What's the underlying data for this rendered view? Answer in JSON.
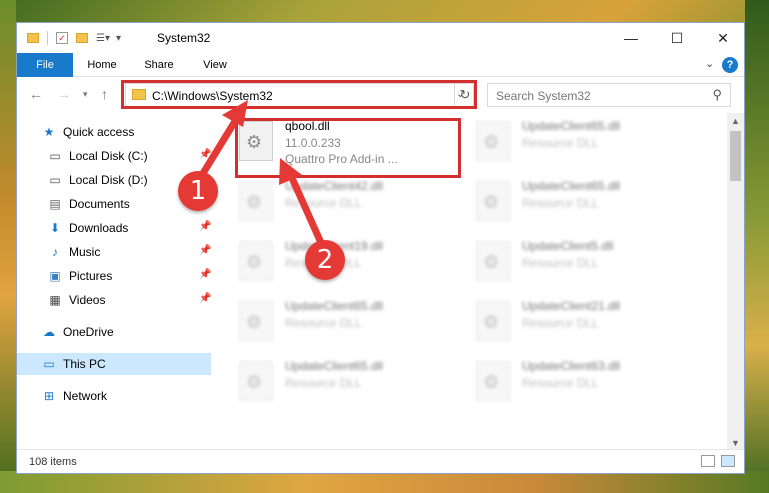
{
  "window": {
    "title": "System32"
  },
  "ribbon": {
    "tabs": [
      "File",
      "Home",
      "Share",
      "View"
    ]
  },
  "address": {
    "path": "C:\\Windows\\System32"
  },
  "search": {
    "placeholder": "Search System32"
  },
  "sidebar": {
    "items": [
      {
        "label": "Quick access",
        "icon": "star-icon"
      },
      {
        "label": "Local Disk (C:)",
        "icon": "drive-icon",
        "pinned": true
      },
      {
        "label": "Local Disk (D:)",
        "icon": "drive-icon"
      },
      {
        "label": "Documents",
        "icon": "documents-icon"
      },
      {
        "label": "Downloads",
        "icon": "download-icon",
        "pinned": true
      },
      {
        "label": "Music",
        "icon": "music-icon",
        "pinned": true
      },
      {
        "label": "Pictures",
        "icon": "pictures-icon",
        "pinned": true
      },
      {
        "label": "Videos",
        "icon": "videos-icon",
        "pinned": true
      },
      {
        "label": "OneDrive",
        "icon": "cloud-icon"
      },
      {
        "label": "This PC",
        "icon": "computer-icon",
        "selected": true
      },
      {
        "label": "Network",
        "icon": "network-icon"
      }
    ]
  },
  "files": [
    {
      "name": "qbool.dll",
      "line2": "11.0.0.233",
      "line3": "Quattro Pro Add-in ...",
      "highlighted": true
    },
    {
      "name": "UpdateClient65.dll",
      "line2": "Resource DLL"
    },
    {
      "name": "UpdateClient42.dll",
      "line2": "Resource DLL"
    },
    {
      "name": "UpdateClient65.dll",
      "line2": "Resource DLL"
    },
    {
      "name": "UpdateClient19.dll",
      "line2": "Resource DLL"
    },
    {
      "name": "UpdateClient5.dll",
      "line2": "Resource DLL"
    },
    {
      "name": "UpdateClient65.dll",
      "line2": "Resource DLL"
    },
    {
      "name": "UpdateClient21.dll",
      "line2": "Resource DLL"
    },
    {
      "name": "UpdateClient65.dll",
      "line2": "Resource DLL"
    },
    {
      "name": "UpdateClient63.dll",
      "line2": "Resource DLL"
    }
  ],
  "status": {
    "count": "108 items"
  },
  "annotations": {
    "step1": "1",
    "step2": "2"
  },
  "colors": {
    "accent": "#1979ca",
    "highlight": "#d32f2f",
    "badge": "#e53935"
  }
}
